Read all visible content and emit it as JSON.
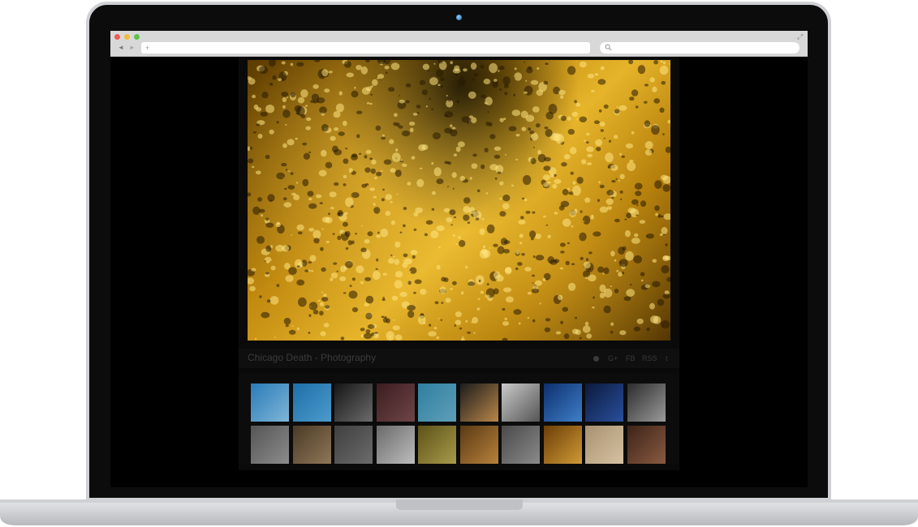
{
  "browser": {
    "url_text": "+",
    "nav_back": "◄",
    "nav_forward": "►",
    "expand_icon": "⤢"
  },
  "site": {
    "title": "Chicago Death - Photography",
    "social": {
      "google": "G+",
      "facebook": "FB",
      "rss": "RSS",
      "tumblr": "t"
    }
  },
  "hero_image": {
    "description_icon": "golden-water-droplets-photo"
  },
  "thumbnails": [
    {
      "name": "wind-turbine",
      "color_a": "#2a7bb8",
      "color_b": "#7fb6d8"
    },
    {
      "name": "blue-sky",
      "color_a": "#1e6fa8",
      "color_b": "#4c9bcc"
    },
    {
      "name": "bokeh-lights",
      "color_a": "#151515",
      "color_b": "#6b6b6b"
    },
    {
      "name": "red-texture",
      "color_a": "#3d1d1f",
      "color_b": "#6e4548"
    },
    {
      "name": "teal-horizon",
      "color_a": "#2f7ea0",
      "color_b": "#5e9fb8"
    },
    {
      "name": "window-frame",
      "color_a": "#1c1c1c",
      "color_b": "#b9864a"
    },
    {
      "name": "power-lines",
      "color_a": "#c9c9c9",
      "color_b": "#555555"
    },
    {
      "name": "blue-light",
      "color_a": "#0d2f6e",
      "color_b": "#3e7fc8"
    },
    {
      "name": "blue-column",
      "color_a": "#0b1a3d",
      "color_b": "#2a4f9c"
    },
    {
      "name": "spiral-pattern",
      "color_a": "#2c2c2c",
      "color_b": "#9a9a9a"
    },
    {
      "name": "grey-waves",
      "color_a": "#555555",
      "color_b": "#8c8c8c"
    },
    {
      "name": "sand-texture",
      "color_a": "#4a3a26",
      "color_b": "#8f7758"
    },
    {
      "name": "grey-surface",
      "color_a": "#3f3f3f",
      "color_b": "#6b6b6b"
    },
    {
      "name": "striped-metal",
      "color_a": "#6a6a6a",
      "color_b": "#bdbdbd"
    },
    {
      "name": "yellow-stripes",
      "color_a": "#5b5218",
      "color_b": "#a99a4a"
    },
    {
      "name": "wood-slats",
      "color_a": "#5a3a14",
      "color_b": "#b8813c"
    },
    {
      "name": "grey-slats",
      "color_a": "#4a4a4a",
      "color_b": "#8a8a8a"
    },
    {
      "name": "amber-glass",
      "color_a": "#6b3e08",
      "color_b": "#d09a36"
    },
    {
      "name": "beige-wall",
      "color_a": "#a89170",
      "color_b": "#d5c2a2"
    },
    {
      "name": "brown-weave",
      "color_a": "#3d2418",
      "color_b": "#8a5a42"
    }
  ],
  "colors": {
    "background": "#000000",
    "title_text": "#3b3b3b",
    "hero_gold": "#e6b42a"
  }
}
